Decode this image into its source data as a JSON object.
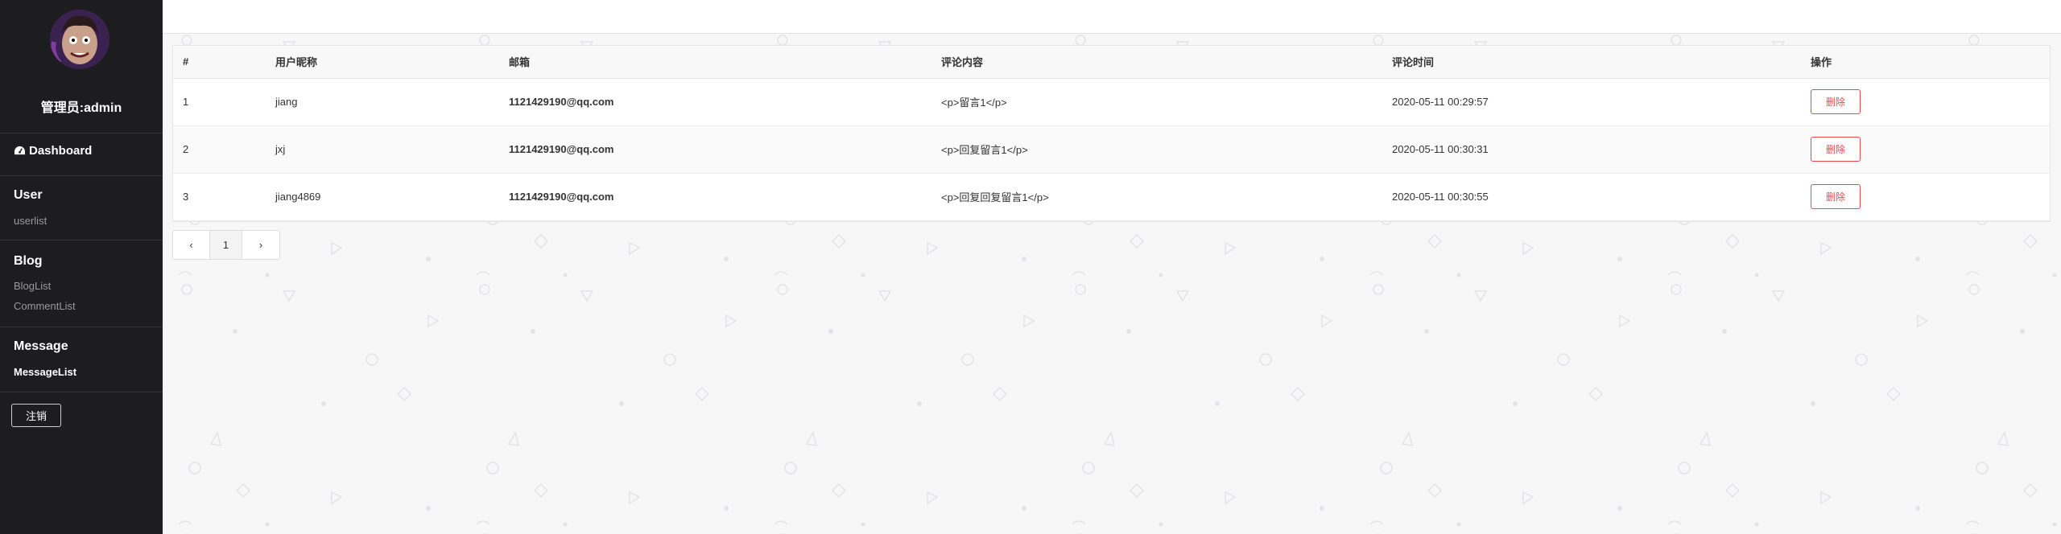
{
  "sidebar": {
    "admin_name": "管理员:admin",
    "dashboard_label": "Dashboard",
    "sections": [
      {
        "title": "User",
        "items": [
          "userlist"
        ]
      },
      {
        "title": "Blog",
        "items": [
          "BlogList",
          "CommentList"
        ]
      },
      {
        "title": "Message",
        "items": [
          "MessageList"
        ]
      }
    ],
    "active_item": "MessageList",
    "logout_label": "注销"
  },
  "table": {
    "headers": [
      "#",
      "用户昵称",
      "邮箱",
      "评论内容",
      "评论时间",
      "操作"
    ],
    "rows": [
      {
        "id": "1",
        "nickname": "jiang",
        "email": "1121429190@qq.com",
        "content": "<p>留言1</p>",
        "time": "2020-05-11 00:29:57",
        "action": "删除"
      },
      {
        "id": "2",
        "nickname": "jxj",
        "email": "1121429190@qq.com",
        "content": "<p>回复留言1</p>",
        "time": "2020-05-11 00:30:31",
        "action": "删除"
      },
      {
        "id": "3",
        "nickname": "jiang4869",
        "email": "1121429190@qq.com",
        "content": "<p>回复回复留言1</p>",
        "time": "2020-05-11 00:30:55",
        "action": "删除"
      }
    ]
  },
  "pagination": {
    "prev": "‹",
    "current": "1",
    "next": "›"
  },
  "colors": {
    "sidebar_bg": "#1d1d1f",
    "danger": "#e8484b",
    "page_bg": "#f7f7f8"
  }
}
